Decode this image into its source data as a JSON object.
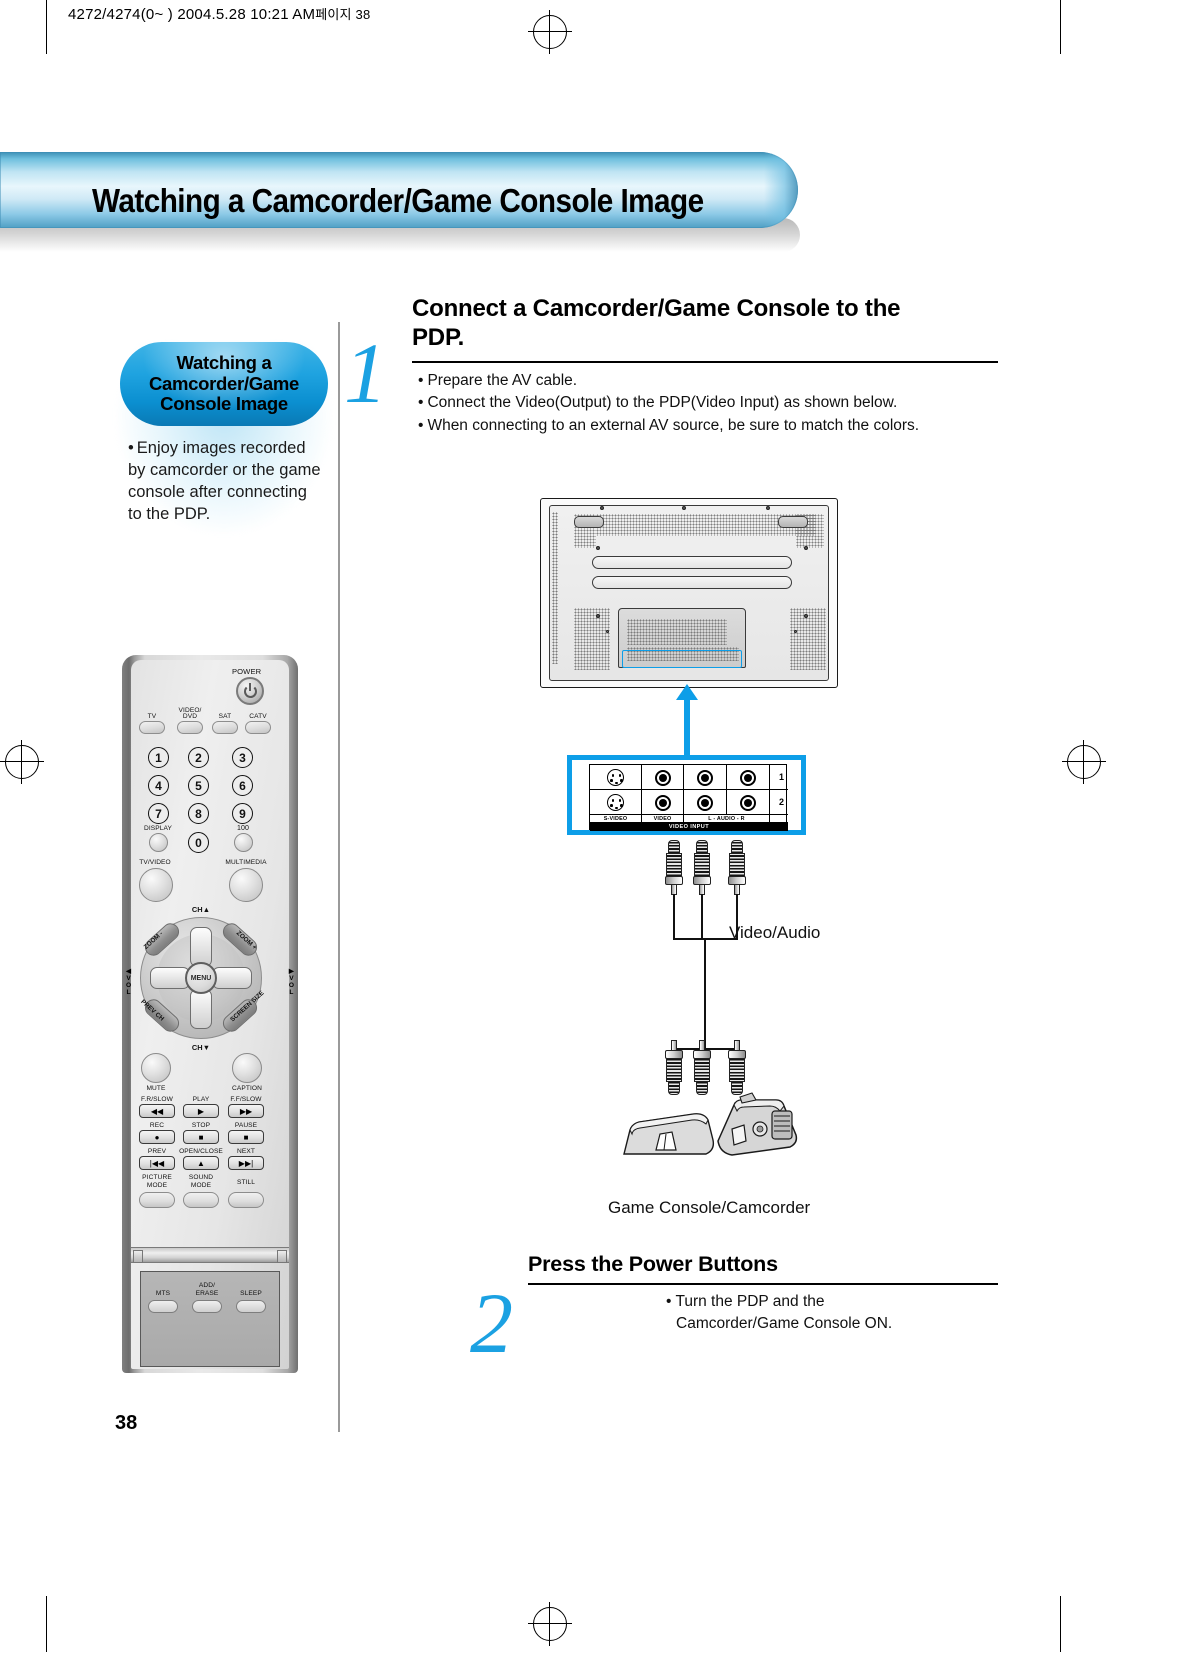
{
  "print_header": {
    "text": "4272/4274(0~ )  2004.5.28 10:21 AM",
    "kr": "페이지 38"
  },
  "banner": {
    "title": "Watching a Camcorder/Game Console Image",
    "accent_color": "#6fc0de"
  },
  "sidebar": {
    "callout_title": "Watching a Camcorder/Game Console Image",
    "callout_color": "#0b8fd0",
    "note_bullet": "•",
    "note": "Enjoy images recorded by camcorder or the game console after connecting to the PDP."
  },
  "steps": [
    {
      "number": "1",
      "heading_line1": "Connect a Camcorder/Game Console to the",
      "heading_line2": "PDP.",
      "bullets": [
        "Prepare the AV cable.",
        "Connect the Video(Output) to the PDP(Video Input) as shown below.",
        "When connecting to an external AV source, be sure to match the colors."
      ]
    },
    {
      "number": "2",
      "heading": "Press the Power Buttons",
      "bullets": [
        "Turn the PDP and the",
        "Camcorder/Game Console ON."
      ]
    }
  ],
  "bullet_char": "•",
  "diagram": {
    "jack_panel": {
      "labels": [
        "S-VIDEO",
        "VIDEO",
        "L - AUDIO - R"
      ],
      "footer": "VIDEO INPUT",
      "row_indices": [
        "1",
        "2"
      ],
      "highlight_color": "#0d9ee8"
    },
    "cable_label": "Video/Audio",
    "device_label": "Game Console/Camcorder"
  },
  "remote": {
    "power_label": "POWER",
    "source_buttons": [
      "TV",
      "VIDEO/\nDVD",
      "SAT",
      "CATV"
    ],
    "source_button_labels": {
      "tv": "TV",
      "video_dvd_l1": "VIDEO/",
      "video_dvd_l2": "DVD",
      "sat": "SAT",
      "catv": "CATV"
    },
    "numbers": [
      "1",
      "2",
      "3",
      "4",
      "5",
      "6",
      "7",
      "8",
      "9",
      "0"
    ],
    "display_label": "DISPLAY",
    "hundred_label": "100",
    "tv_video_label": "TV/VIDEO",
    "multimedia_label": "MULTIMEDIA",
    "ch_up_label": "CH",
    "ch_down_label": "CH",
    "vol_label_letters": [
      "V",
      "O",
      "L"
    ],
    "menu_label": "MENU",
    "zoom_minus_label": "ZOOM -",
    "zoom_plus_label": "ZOOM +",
    "prev_ch_label": "PREV CH",
    "screen_size_label": "SCREEN SIZE",
    "mute_label": "MUTE",
    "caption_label": "CAPTION",
    "transport": [
      {
        "label": "F.R/SLOW",
        "glyph": "◀◀"
      },
      {
        "label": "PLAY",
        "glyph": "▶"
      },
      {
        "label": "F.F/SLOW",
        "glyph": "▶▶"
      },
      {
        "label": "REC",
        "glyph": "●"
      },
      {
        "label": "STOP",
        "glyph": "■"
      },
      {
        "label": "PAUSE",
        "glyph": "■"
      },
      {
        "label": "PREV",
        "glyph": "|◀◀"
      },
      {
        "label": "OPEN/CLOSE",
        "glyph": "▲"
      },
      {
        "label": "NEXT",
        "glyph": "▶▶|"
      }
    ],
    "mode_buttons": [
      {
        "l1": "PICTURE",
        "l2": "MODE"
      },
      {
        "l1": "SOUND",
        "l2": "MODE"
      },
      {
        "l1": "STILL",
        "l2": ""
      }
    ],
    "tray_buttons": [
      {
        "l1": "MTS",
        "l2": ""
      },
      {
        "l1": "ADD/",
        "l2": "ERASE"
      },
      {
        "l1": "SLEEP",
        "l2": ""
      }
    ]
  },
  "page_number": "38"
}
